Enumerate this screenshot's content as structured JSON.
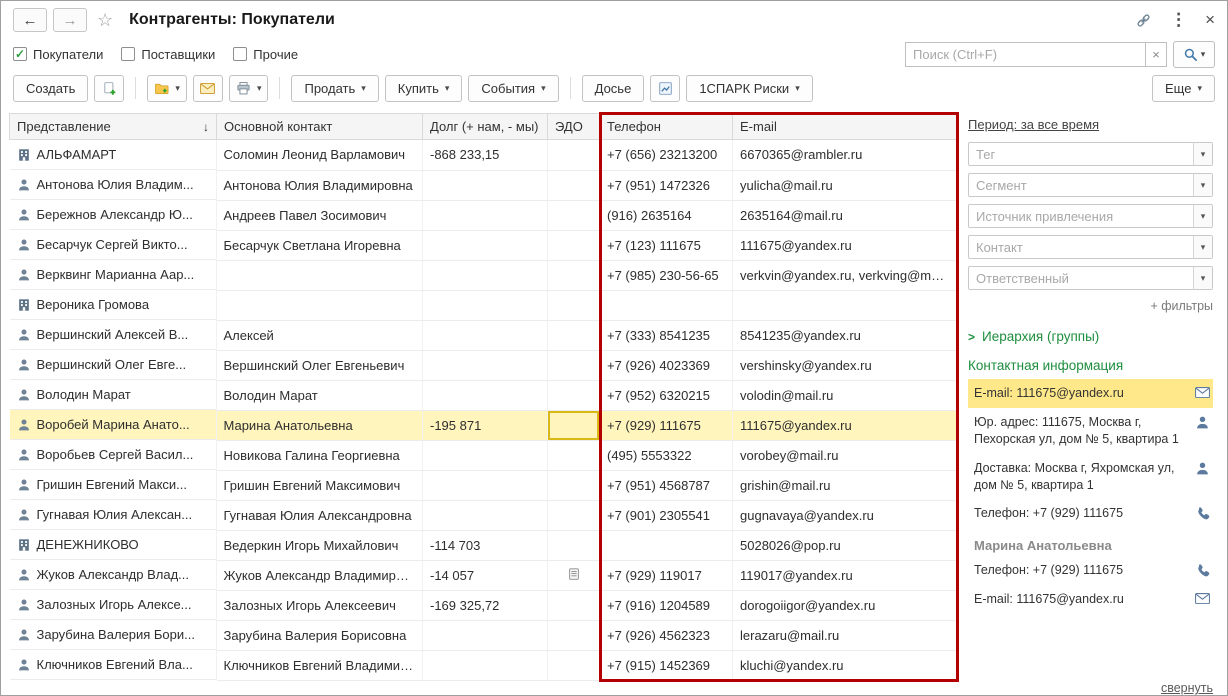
{
  "titlebar": {
    "title": "Контрагенты: Покупатели"
  },
  "icons": {
    "back": "←",
    "forward": "→",
    "favorite": "☆",
    "window_menu": "⋮",
    "close": "×",
    "clear_search": "×",
    "search": "magnifier",
    "link": "chain-link",
    "dropdown": "▾",
    "sort_desc": "↓",
    "check": "✓",
    "hierarchy_chevron": ">"
  },
  "tabs_row": {
    "checkboxes": [
      {
        "label": "Покупатели",
        "checked": true
      },
      {
        "label": "Поставщики",
        "checked": false
      },
      {
        "label": "Прочие",
        "checked": false
      }
    ],
    "search": {
      "placeholder": "Поиск (Ctrl+F)"
    }
  },
  "toolbar": {
    "create": "Создать",
    "sell": "Продать",
    "buy": "Купить",
    "events": "События",
    "dossier": "Досье",
    "spark": "1СПАРК Риски",
    "more": "Еще"
  },
  "table": {
    "columns": {
      "name": "Представление",
      "contact": "Основной контакт",
      "debt": "Долг (+ нам, - мы)",
      "edo": "ЭДО",
      "phone": "Телефон",
      "email": "E-mail"
    },
    "rows": [
      {
        "icon": "building",
        "name": "АЛЬФАМАРТ",
        "contact": "Соломин Леонид Варламович",
        "debt": "-868 233,15",
        "edo": false,
        "phone": "+7 (656) 23213200",
        "email": "6670365@rambler.ru",
        "selected": false
      },
      {
        "icon": "person",
        "name": "Антонова Юлия Владим...",
        "contact": "Антонова Юлия Владимировна",
        "debt": "",
        "edo": false,
        "phone": "+7 (951) 1472326",
        "email": "yulicha@mail.ru",
        "selected": false
      },
      {
        "icon": "person",
        "name": "Бережнов Александр Ю...",
        "contact": "Андреев Павел Зосимович",
        "debt": "",
        "edo": false,
        "phone": "(916) 2635164",
        "email": "2635164@mail.ru",
        "selected": false
      },
      {
        "icon": "person",
        "name": "Бесарчук Сергей Викто...",
        "contact": "Бесарчук Светлана Игоревна",
        "debt": "",
        "edo": false,
        "phone": "+7 (123) 111675",
        "email": "111675@yandex.ru",
        "selected": false
      },
      {
        "icon": "person",
        "name": "Верквинг Марианна Аар...",
        "contact": "",
        "debt": "",
        "edo": false,
        "phone": "+7 (985) 230-56-65",
        "email": "verkvin@yandex.ru, verkving@mail.ru",
        "selected": false
      },
      {
        "icon": "building",
        "name": "Вероника Громова",
        "contact": "",
        "debt": "",
        "edo": false,
        "phone": "",
        "email": "",
        "selected": false
      },
      {
        "icon": "person",
        "name": "Вершинский Алексей В...",
        "contact": "Алексей",
        "debt": "",
        "edo": false,
        "phone": "+7 (333) 8541235",
        "email": "8541235@yandex.ru",
        "selected": false
      },
      {
        "icon": "person",
        "name": "Вершинский Олег Евге...",
        "contact": "Вершинский Олег Евгеньевич",
        "debt": "",
        "edo": false,
        "phone": "+7 (926) 4023369",
        "email": "vershinsky@yandex.ru",
        "selected": false
      },
      {
        "icon": "person",
        "name": "Володин Марат",
        "contact": "Володин Марат",
        "debt": "",
        "edo": false,
        "phone": "+7 (952) 6320215",
        "email": "volodin@mail.ru",
        "selected": false
      },
      {
        "icon": "person",
        "name": "Воробей Марина Анато...",
        "contact": "Марина Анатольевна",
        "debt": "-195 871",
        "edo": false,
        "phone": "+7 (929) 111675",
        "email": "111675@yandex.ru",
        "selected": true
      },
      {
        "icon": "person",
        "name": "Воробьев Сергей Васил...",
        "contact": "Новикова Галина Георгиевна",
        "debt": "",
        "edo": false,
        "phone": "(495) 5553322",
        "email": "vorobey@mail.ru",
        "selected": false
      },
      {
        "icon": "person",
        "name": "Гришин Евгений Макси...",
        "contact": "Гришин Евгений Максимович",
        "debt": "",
        "edo": false,
        "phone": "+7 (951) 4568787",
        "email": "grishin@mail.ru",
        "selected": false
      },
      {
        "icon": "person",
        "name": "Гугнавая Юлия Алексан...",
        "contact": "Гугнавая Юлия Александровна",
        "debt": "",
        "edo": false,
        "phone": "+7 (901) 2305541",
        "email": "gugnavaya@yandex.ru",
        "selected": false
      },
      {
        "icon": "building",
        "name": "ДЕНЕЖНИКОВО",
        "contact": "Ведеркин Игорь Михайлович",
        "debt": "-114 703",
        "edo": false,
        "phone": "",
        "email": "5028026@pop.ru",
        "selected": false
      },
      {
        "icon": "person",
        "name": "Жуков Александр Влад...",
        "contact": "Жуков Александр Владимирович",
        "debt": "-14 057",
        "edo": true,
        "phone": "+7 (929) 119017",
        "email": "119017@yandex.ru",
        "selected": false
      },
      {
        "icon": "person",
        "name": "Залозных Игорь Алексе...",
        "contact": "Залозных Игорь Алексеевич",
        "debt": "-169 325,72",
        "edo": false,
        "phone": "+7 (916) 1204589",
        "email": "dorogoiigor@yandex.ru",
        "selected": false
      },
      {
        "icon": "person",
        "name": "Зарубина Валерия Бори...",
        "contact": "Зарубина Валерия Борисовна",
        "debt": "",
        "edo": false,
        "phone": "+7 (926) 4562323",
        "email": "lerazaru@mail.ru",
        "selected": false
      },
      {
        "icon": "person",
        "name": "Ключников Евгений Вла...",
        "contact": "Ключников Евгений Владимиров.",
        "debt": "",
        "edo": false,
        "phone": "+7 (915) 1452369",
        "email": "kluchi@yandex.ru",
        "selected": false
      }
    ]
  },
  "sidebar": {
    "period": "Период: за все время",
    "filters": [
      {
        "placeholder": "Тег"
      },
      {
        "placeholder": "Сегмент"
      },
      {
        "placeholder": "Источник привлечения"
      },
      {
        "placeholder": "Контакт"
      },
      {
        "placeholder": "Ответственный"
      }
    ],
    "more_filters": "+ фильтры",
    "hierarchy": "Иерархия (группы)",
    "contact_header": "Контактная информация",
    "contact_items": [
      {
        "type": "item",
        "icon": "envelope",
        "text": "E-mail: 111675@yandex.ru",
        "highlighted": true
      },
      {
        "type": "item",
        "icon": "address",
        "text": "Юр. адрес: 111675, Москва г, Пехорская ул, дом № 5, квартира 1",
        "highlighted": false
      },
      {
        "type": "item",
        "icon": "address",
        "text": "Доставка: Москва г, Яхромская ул, дом № 5, квартира 1",
        "highlighted": false
      },
      {
        "type": "item",
        "icon": "phone",
        "text": "Телефон: +7 (929) 111675",
        "highlighted": false
      },
      {
        "type": "header",
        "text": "Марина Анатольевна"
      },
      {
        "type": "item",
        "icon": "phone",
        "text": "Телефон: +7 (929) 111675",
        "highlighted": false
      },
      {
        "type": "item",
        "icon": "envelope",
        "text": "E-mail: 111675@yandex.ru",
        "highlighted": false
      }
    ],
    "collapse": "свернуть"
  },
  "colors": {
    "accent_green": "#1e8e3e",
    "selection_yellow": "#fff5bd",
    "sidebar_highlight": "#ffe88a",
    "annotation_red": "#b30000"
  }
}
